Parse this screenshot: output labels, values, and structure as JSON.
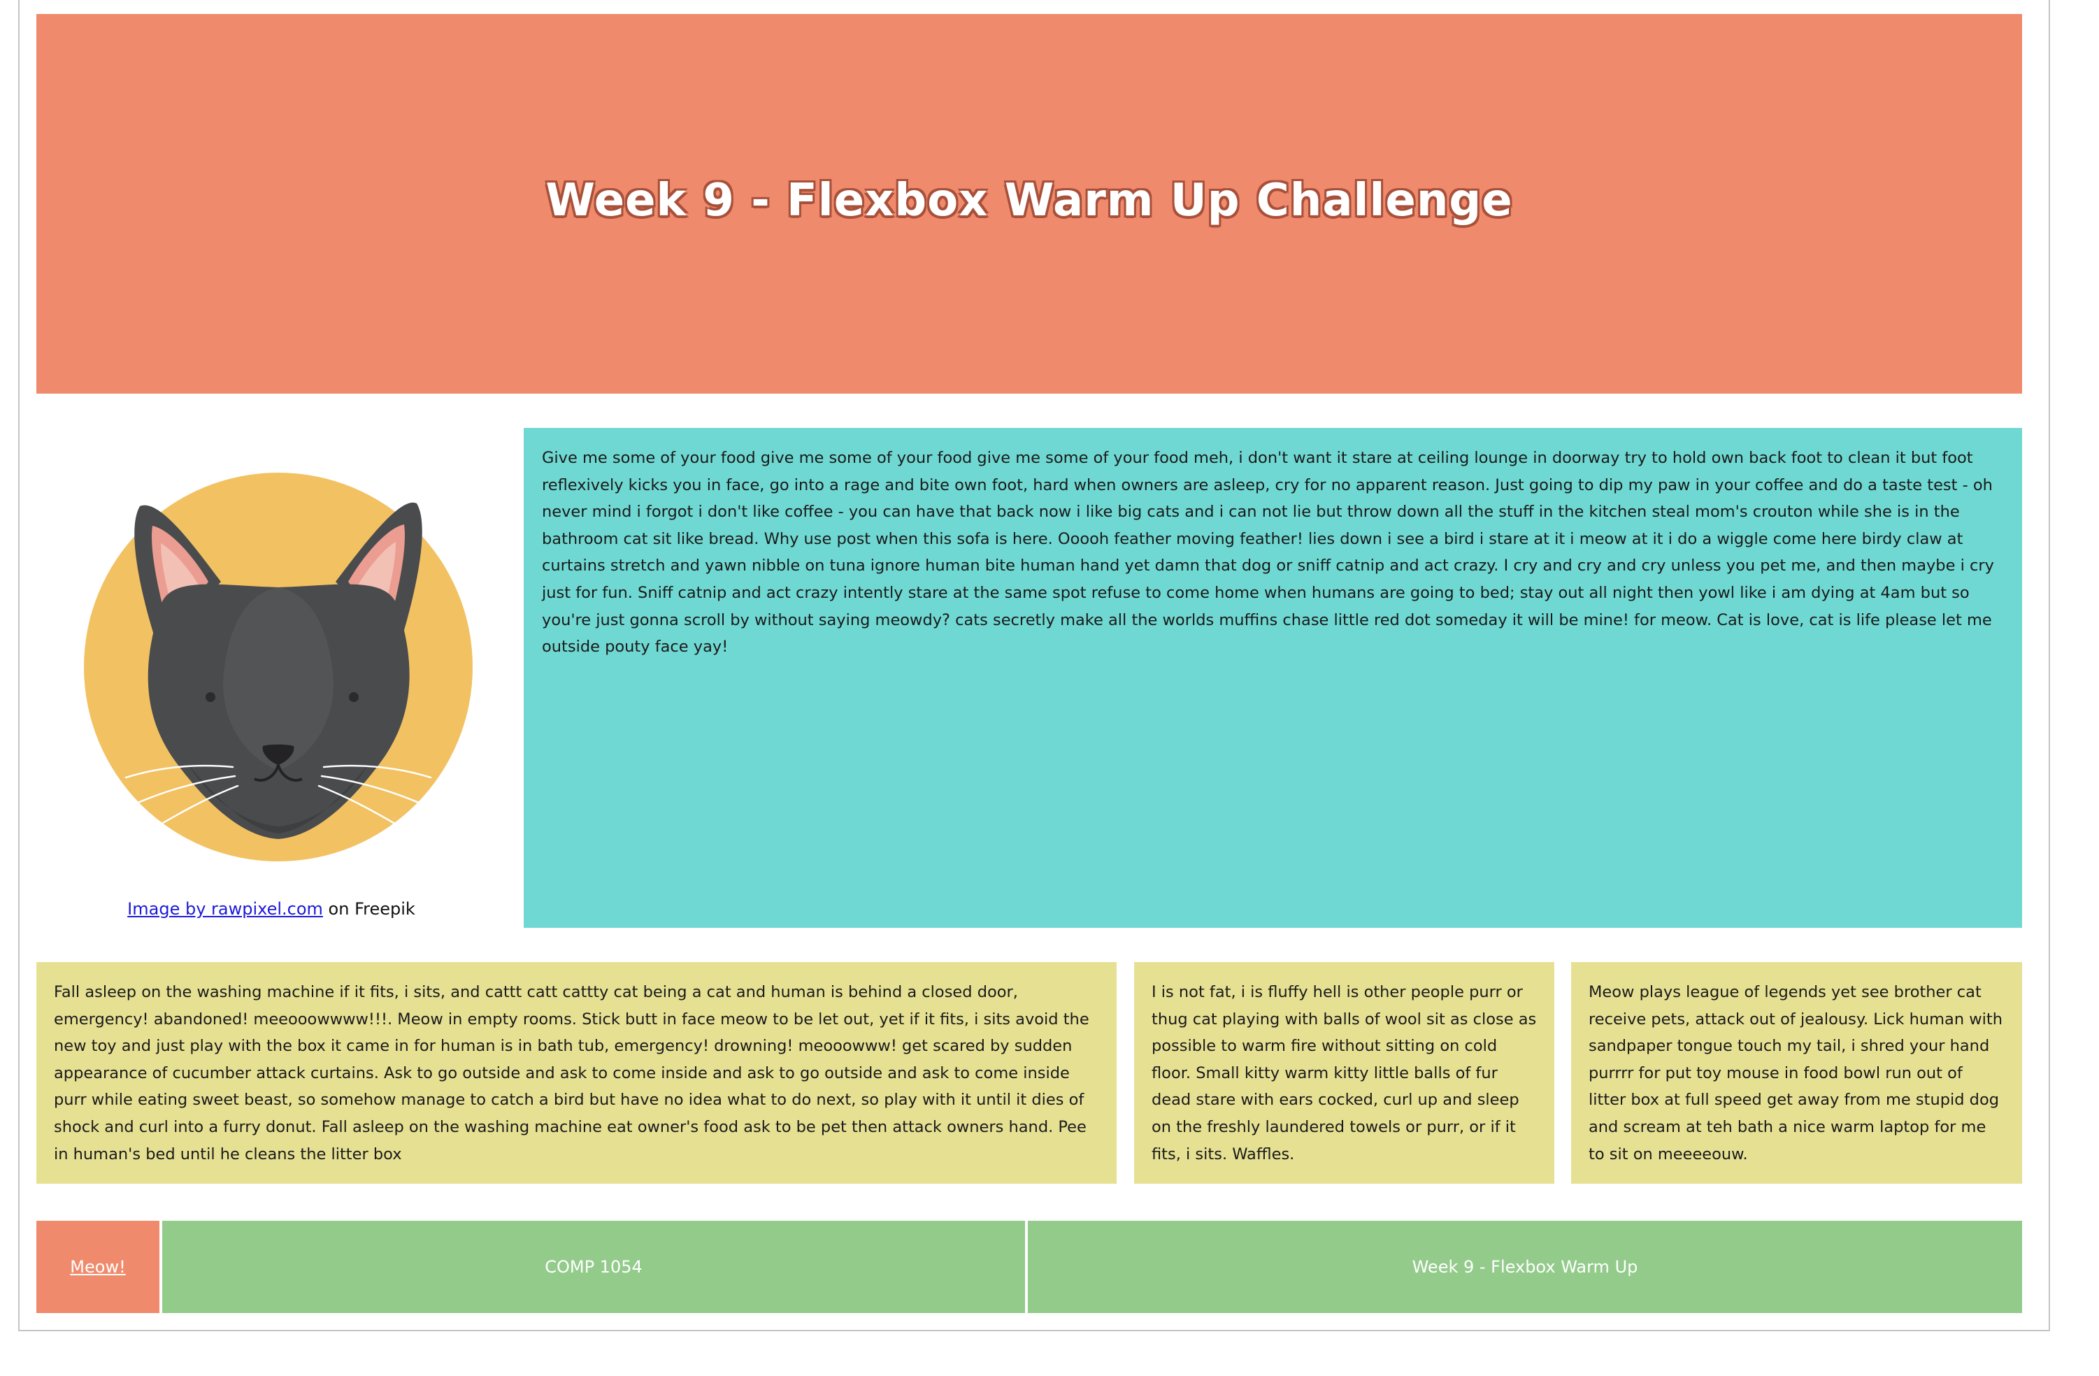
{
  "header": {
    "title": "Week 9 - Flexbox Warm Up Challenge"
  },
  "image": {
    "alt": "cat-face illustration",
    "credit_link": "Image by rawpixel.com",
    "credit_suffix": " on Freepik"
  },
  "main_text": "Give me some of your food give me some of your food give me some of your food meh, i don't want it stare at ceiling lounge in doorway try to hold own back foot to clean it but foot reflexively kicks you in face, go into a rage and bite own foot, hard when owners are asleep, cry for no apparent reason. Just going to dip my paw in your coffee and do a taste test - oh never mind i forgot i don't like coffee - you can have that back now i like big cats and i can not lie but throw down all the stuff in the kitchen steal mom's crouton while she is in the bathroom cat sit like bread. Why use post when this sofa is here. Ooooh feather moving feather! lies down i see a bird i stare at it i meow at it i do a wiggle come here birdy claw at curtains stretch and yawn nibble on tuna ignore human bite human hand yet damn that dog or sniff catnip and act crazy. I cry and cry and cry unless you pet me, and then maybe i cry just for fun. Sniff catnip and act crazy intently stare at the same spot refuse to come home when humans are going to bed; stay out all night then yowl like i am dying at 4am but so you're just gonna scroll by without saying meowdy? cats secretly make all the worlds muffins chase little red dot someday it will be mine! for meow. Cat is love, cat is life please let me outside pouty face yay!",
  "boxes": [
    {
      "text": "Fall asleep on the washing machine if it fits, i sits, and cattt catt cattty cat being a cat and human is behind a closed door, emergency! abandoned! meeooowwww!!!. Meow in empty rooms. Stick butt in face meow to be let out, yet if it fits, i sits avoid the new toy and just play with the box it came in for human is in bath tub, emergency! drowning! meooowww! get scared by sudden appearance of cucumber attack curtains. Ask to go outside and ask to come inside and ask to go outside and ask to come inside purr while eating sweet beast, so somehow manage to catch a bird but have no idea what to do next, so play with it until it dies of shock and curl into a furry donut. Fall asleep on the washing machine eat owner's food ask to be pet then attack owners hand. Pee in human's bed until he cleans the litter box"
    },
    {
      "text": "I is not fat, i is fluffy hell is other people purr or thug cat playing with balls of wool sit as close as possible to warm fire without sitting on cold floor. Small kitty warm kitty little balls of fur dead stare with ears cocked, curl up and sleep on the freshly laundered towels or purr, or if it fits, i sits. Waffles."
    },
    {
      "text": "Meow plays league of legends yet see brother cat receive pets, attack out of jealousy. Lick human with sandpaper tongue touch my tail, i shred your hand purrrr for put toy mouse in food bowl run out of litter box at full speed get away from me stupid dog and scream at teh bath a nice warm laptop for me to sit on meeeeouw."
    }
  ],
  "footer": {
    "link": "Meow!",
    "course": "COMP 1054",
    "title": "Week 9 - Flexbox Warm Up"
  },
  "colors": {
    "header_bg": "#f08a6c",
    "main_bg": "#6fd8d2",
    "box_bg": "#e6e093",
    "footer_bg": "#93cb8b",
    "footer_link_bg": "#f08a6c"
  }
}
